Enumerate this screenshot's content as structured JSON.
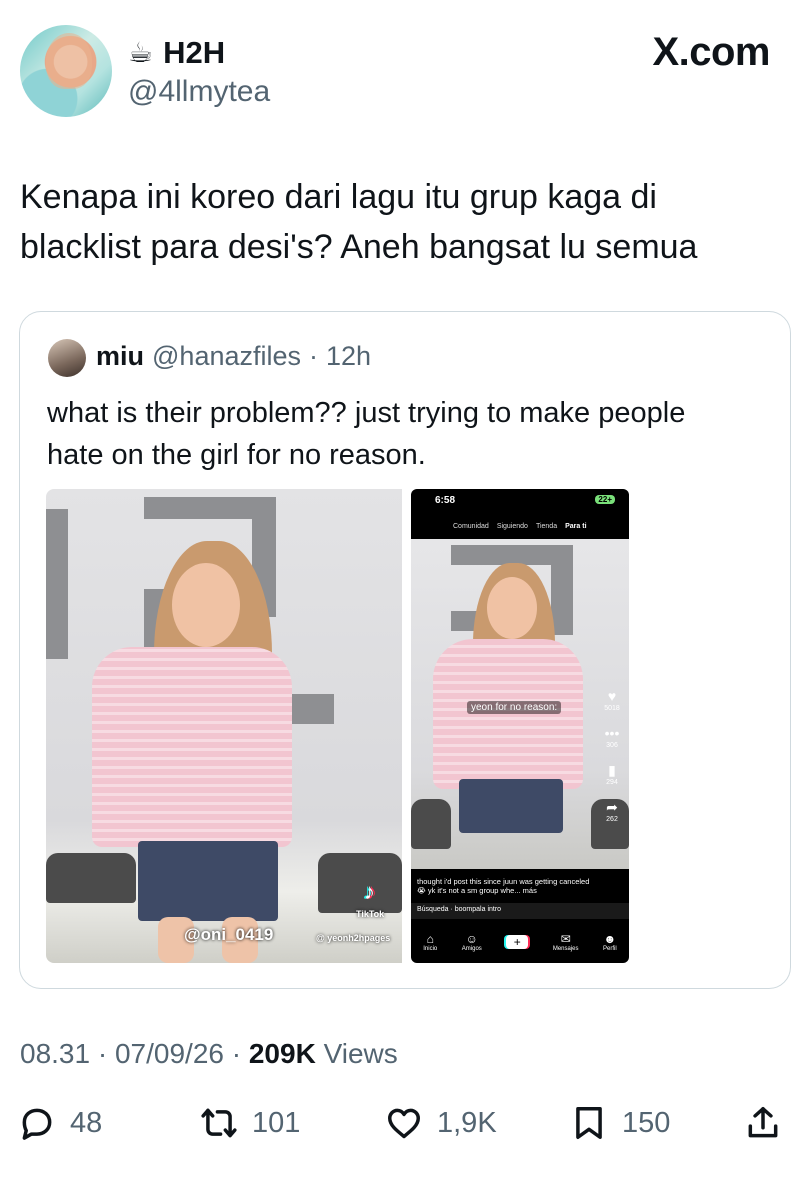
{
  "header": {
    "emoji": "☕",
    "display_name": "H2H",
    "handle": "@4llmytea",
    "brand": "X.com"
  },
  "tweet": {
    "text_line1": "Kenapa ini koreo dari lagu itu grup kaga di",
    "text_line2": "blacklist para desi's? Aneh bangsat lu semua"
  },
  "quote": {
    "name": "miu",
    "handle": "@hanazfiles",
    "separator": "·",
    "time": "12h",
    "text_line1": "what is their problem?? just trying to make people",
    "text_line2": "hate on the girl for no reason.",
    "media_left": {
      "watermark": "@oni_0419",
      "tiktok_label": "TikTok",
      "tiktok_user": "@ yeonh2hpages"
    },
    "media_right": {
      "clock": "6:58",
      "battery": "22+",
      "nav": [
        "Comunidad",
        "Siguiendo",
        "Tienda",
        "Para ti"
      ],
      "overlay_text": "yeon for no reason:",
      "side_counts": [
        "5018",
        "306",
        "294",
        "262"
      ],
      "caption": "thought i'd post this since juun was getting canceled 😭 yk it's not a sm group whe... más",
      "search": "Búsqueda · boompala intro",
      "bottom_nav": [
        "Inicio",
        "Amigos",
        "+",
        "Mensajes",
        "Perfil"
      ]
    }
  },
  "meta": {
    "time": "08.31",
    "date": "07/09/26",
    "views_count": "209K",
    "views_label": "Views",
    "dot": "·"
  },
  "actions": {
    "replies": "48",
    "reposts": "101",
    "likes": "1,9K",
    "bookmarks": "150"
  },
  "colors": {
    "secondary_text": "#536471",
    "border": "#cfd9de",
    "primary_text": "#0f1419"
  }
}
